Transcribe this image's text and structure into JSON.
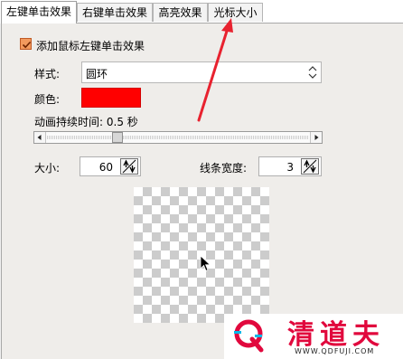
{
  "tabs": [
    {
      "label": "左键单击效果",
      "active": true
    },
    {
      "label": "右键单击效果",
      "active": false
    },
    {
      "label": "高亮效果",
      "active": false
    },
    {
      "label": "光标大小",
      "active": false
    }
  ],
  "checkbox": {
    "label": "添加鼠标左键单击效果",
    "checked": true
  },
  "style": {
    "label": "样式:",
    "value": "圆环"
  },
  "color": {
    "label": "颜色:",
    "value": "#ff0000"
  },
  "duration": {
    "label": "动画持续时间:",
    "value": "0.5 秒",
    "slider_fraction": 0.26
  },
  "size": {
    "label": "大小:",
    "value": "60"
  },
  "line_width": {
    "label": "线条宽度:",
    "value": "3"
  },
  "watermark": {
    "brand": "清道夫",
    "url": "WWW.QDFUJI.COM",
    "accent": "#e1083d"
  }
}
